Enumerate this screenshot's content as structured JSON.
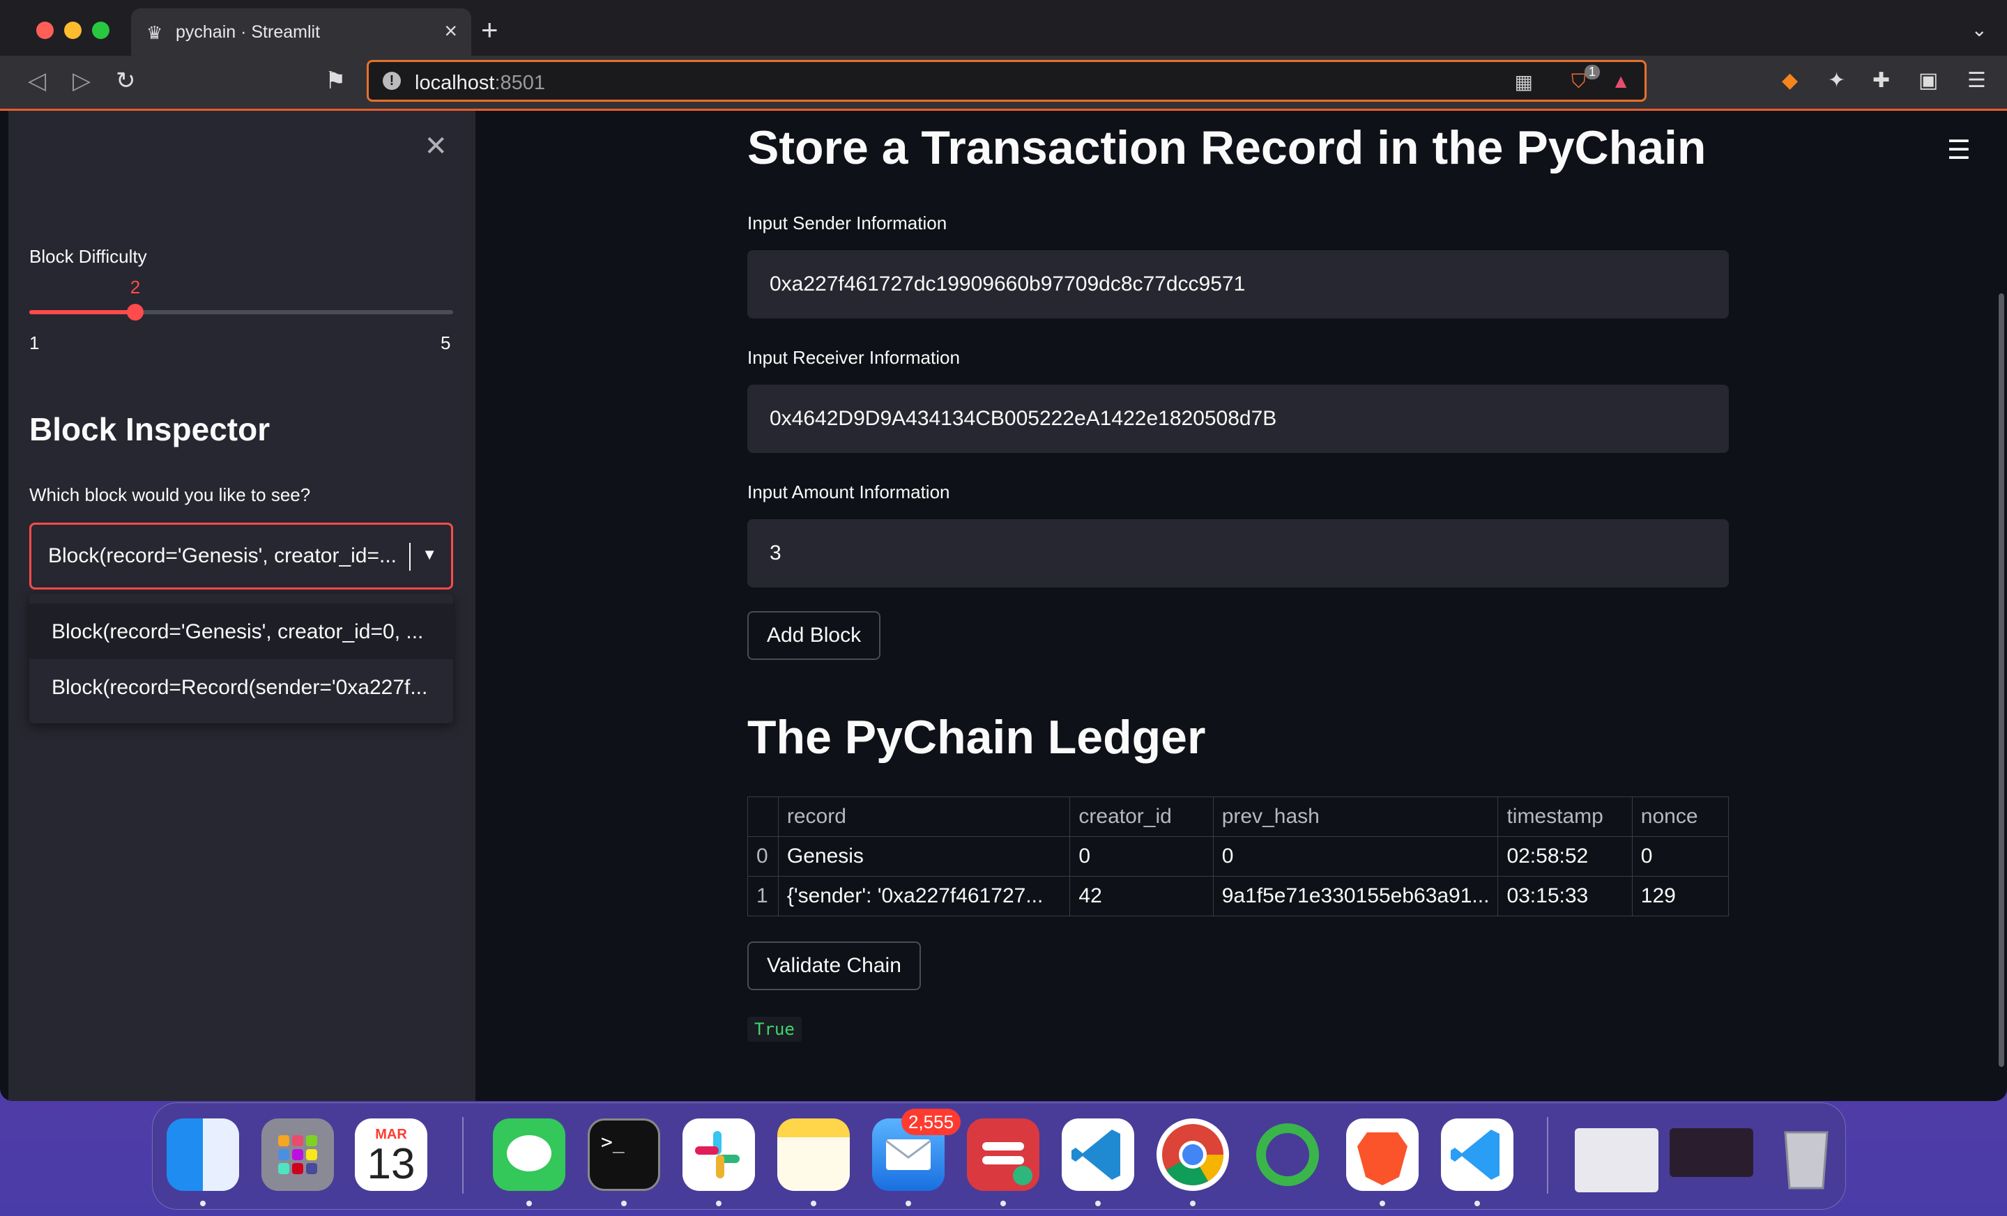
{
  "browser": {
    "tab_title": "pychain · Streamlit",
    "tab_favicon": "streamlit-crown-icon",
    "url_host": "localhost",
    "url_port": ":8501",
    "shield_badge": "1"
  },
  "sidebar": {
    "difficulty_label": "Block Difficulty",
    "difficulty_value": "2",
    "difficulty_min": "1",
    "difficulty_max": "5",
    "difficulty_fraction": 0.25,
    "inspector_heading": "Block Inspector",
    "select_label": "Which block would you like to see?",
    "select_value": "Block(record='Genesis', creator_id=...",
    "options": [
      "Block(record='Genesis', creator_id=0, ...",
      "Block(record=Record(sender='0xa227f..."
    ]
  },
  "main": {
    "title": "Store a Transaction Record in the PyChain",
    "sender_label": "Input Sender Information",
    "sender_value": "0xa227f461727dc19909660b97709dc8c77dcc9571",
    "receiver_label": "Input Receiver Information",
    "receiver_value": "0x4642D9D9A434134CB005222eA1422e1820508d7B",
    "amount_label": "Input Amount Information",
    "amount_value": "3",
    "add_block_label": "Add Block",
    "ledger_title": "The PyChain Ledger",
    "ledger_columns": [
      "",
      "record",
      "creator_id",
      "prev_hash",
      "timestamp",
      "nonce"
    ],
    "ledger_rows": [
      [
        "0",
        "Genesis",
        "0",
        "0",
        "02:58:52",
        "0"
      ],
      [
        "1",
        "{'sender': '0xa227f461727...",
        "42",
        "9a1f5e71e330155eb63a91...",
        "03:15:33",
        "129"
      ]
    ],
    "validate_label": "Validate Chain",
    "validate_result": "True"
  },
  "dock": {
    "calendar_month": "MAR",
    "calendar_day": "13",
    "mail_badge": "2,555",
    "apps": [
      "finder-icon",
      "launchpad-icon",
      "calendar-icon",
      "messages-icon",
      "terminal-icon",
      "slack-icon",
      "notes-icon",
      "mail-icon",
      "expressvpn-icon",
      "vscode-icon",
      "chrome-icon",
      "ring-app-icon",
      "brave-icon",
      "vscode-insiders-icon",
      "window-thumbnail-1",
      "window-thumbnail-2",
      "trash-icon"
    ]
  },
  "colors": {
    "accent": "#ff4b4b",
    "background": "#0e1117",
    "sidebar": "#262730",
    "success_text": "#3dd56d"
  }
}
